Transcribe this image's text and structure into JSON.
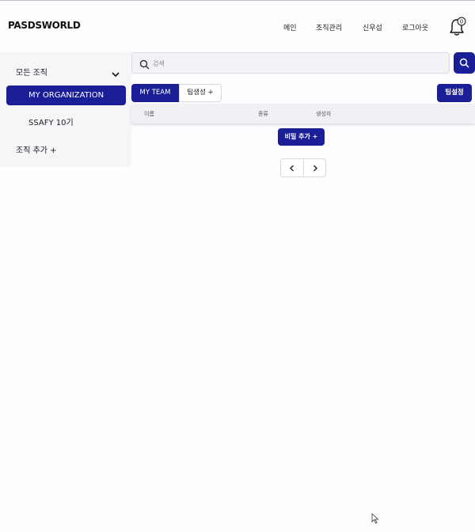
{
  "header": {
    "logo": "PASDSWORLD",
    "nav": [
      "메인",
      "조직관리",
      "신우섭",
      "로그아웃"
    ],
    "notification_count": "0"
  },
  "sidebar": {
    "all_orgs": "모든 조직",
    "active_item": "MY ORGANIZATION",
    "item": "SSAFY 10기",
    "add_org": "조직 추가 +"
  },
  "search": {
    "placeholder": "검색"
  },
  "tabs": {
    "my_team": "MY TEAM",
    "create_team": "팀생성 +"
  },
  "team_setting": "팀설정",
  "table": {
    "headers": [
      "이름",
      "종류",
      "생성자"
    ]
  },
  "add_secret": "비밀 추가 +",
  "colors": {
    "accent": "#1a1f98",
    "background": "#fdfcff",
    "sidebar": "#f6f6f9"
  },
  "icons": [
    "bell-icon",
    "chevron-down-icon",
    "search-icon",
    "chevron-left-icon",
    "chevron-right-icon"
  ]
}
